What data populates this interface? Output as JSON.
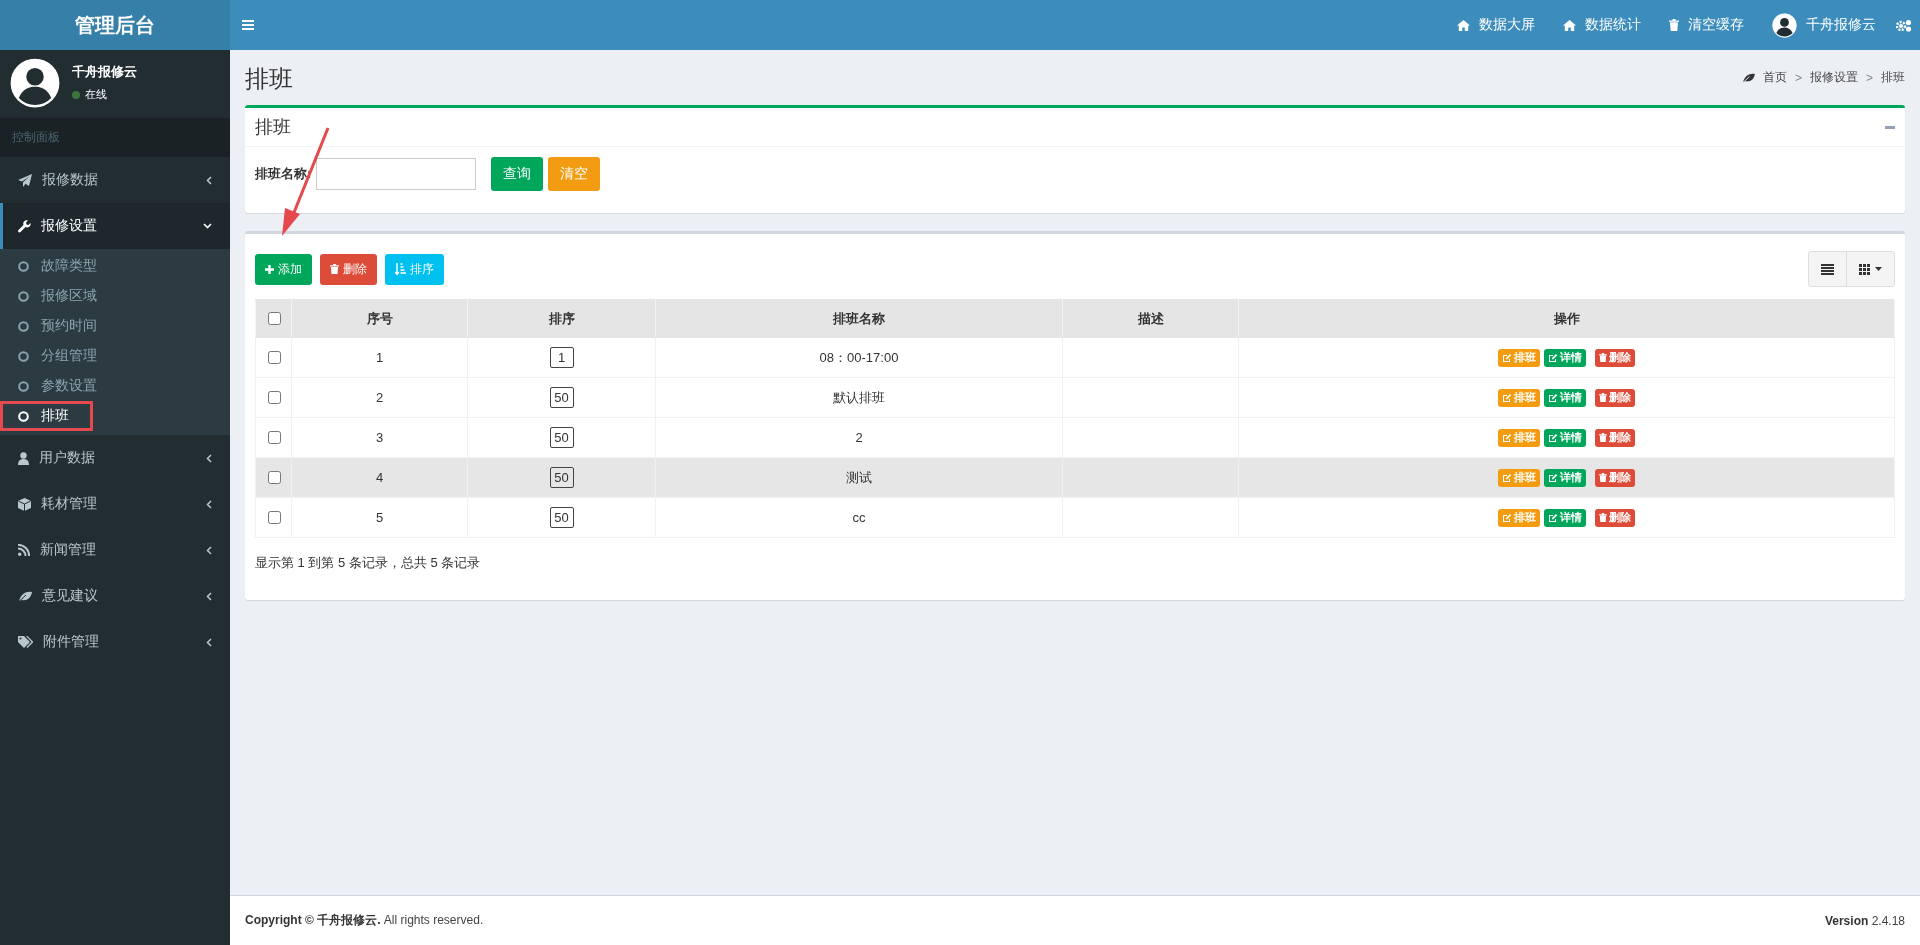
{
  "sidebar": {
    "brand": "管理后台",
    "user": {
      "name": "千舟报修云",
      "status": "在线",
      "online": true
    },
    "header": "控制面板",
    "items": [
      {
        "label": "报修数据",
        "expanded": false,
        "selected": false
      },
      {
        "label": "报修设置",
        "expanded": true,
        "selected": true,
        "children": [
          {
            "label": "故障类型",
            "selected": false,
            "highlighted": false
          },
          {
            "label": "报修区域",
            "selected": false,
            "highlighted": false
          },
          {
            "label": "预约时间",
            "selected": false,
            "highlighted": false
          },
          {
            "label": "分组管理",
            "selected": false,
            "highlighted": false
          },
          {
            "label": "参数设置",
            "selected": false,
            "highlighted": false
          },
          {
            "label": "排班",
            "selected": true,
            "highlighted": true
          }
        ]
      },
      {
        "label": "用户数据",
        "expanded": false,
        "selected": false
      },
      {
        "label": "耗材管理",
        "expanded": false,
        "selected": false
      },
      {
        "label": "新闻管理",
        "expanded": false,
        "selected": false
      },
      {
        "label": "意见建议",
        "expanded": false,
        "selected": false
      },
      {
        "label": "附件管理",
        "expanded": false,
        "selected": false
      }
    ]
  },
  "topbar": {
    "links": [
      {
        "label": "数据大屏"
      },
      {
        "label": "数据统计"
      },
      {
        "label": "清空缓存"
      }
    ],
    "user": "千舟报修云"
  },
  "page": {
    "title": "排班",
    "breadcrumb": {
      "items": [
        "首页",
        "报修设置",
        "排班"
      ],
      "separators": [
        ">",
        ">"
      ]
    }
  },
  "search_box": {
    "title": "排班",
    "label": "排班名称:",
    "buttons": [
      "查询",
      "清空"
    ]
  },
  "toolbar": {
    "buttons": [
      "添加",
      "删除",
      "排序"
    ]
  },
  "table": {
    "columns": [
      "序号",
      "排序",
      "排班名称",
      "描述",
      "操作"
    ],
    "all_checked": false,
    "rows": [
      {
        "checked": false,
        "hovered": false,
        "no": "1",
        "order": "1",
        "name": "08：00-17:00",
        "actions": [
          "排班",
          "详情",
          "删除"
        ]
      },
      {
        "checked": false,
        "hovered": false,
        "no": "2",
        "order": "50",
        "name": "默认排班",
        "actions": [
          "排班",
          "详情",
          "删除"
        ]
      },
      {
        "checked": false,
        "hovered": false,
        "no": "3",
        "order": "50",
        "name": "2",
        "actions": [
          "排班",
          "详情",
          "删除"
        ]
      },
      {
        "checked": false,
        "hovered": true,
        "no": "4",
        "order": "50",
        "name": "测试",
        "actions": [
          "排班",
          "详情",
          "删除"
        ]
      },
      {
        "checked": false,
        "hovered": false,
        "no": "5",
        "order": "50",
        "name": "cc",
        "actions": [
          "排班",
          "详情",
          "删除"
        ]
      }
    ],
    "pagination": "显示第 1 到第 5 条记录，总共 5 条记录"
  },
  "annotation": {
    "kind": "arrow"
  },
  "footer": {
    "copyright": "**Copyright © 千舟报修云.** All rights reserved.",
    "version": "**Version** 2.4.18"
  }
}
